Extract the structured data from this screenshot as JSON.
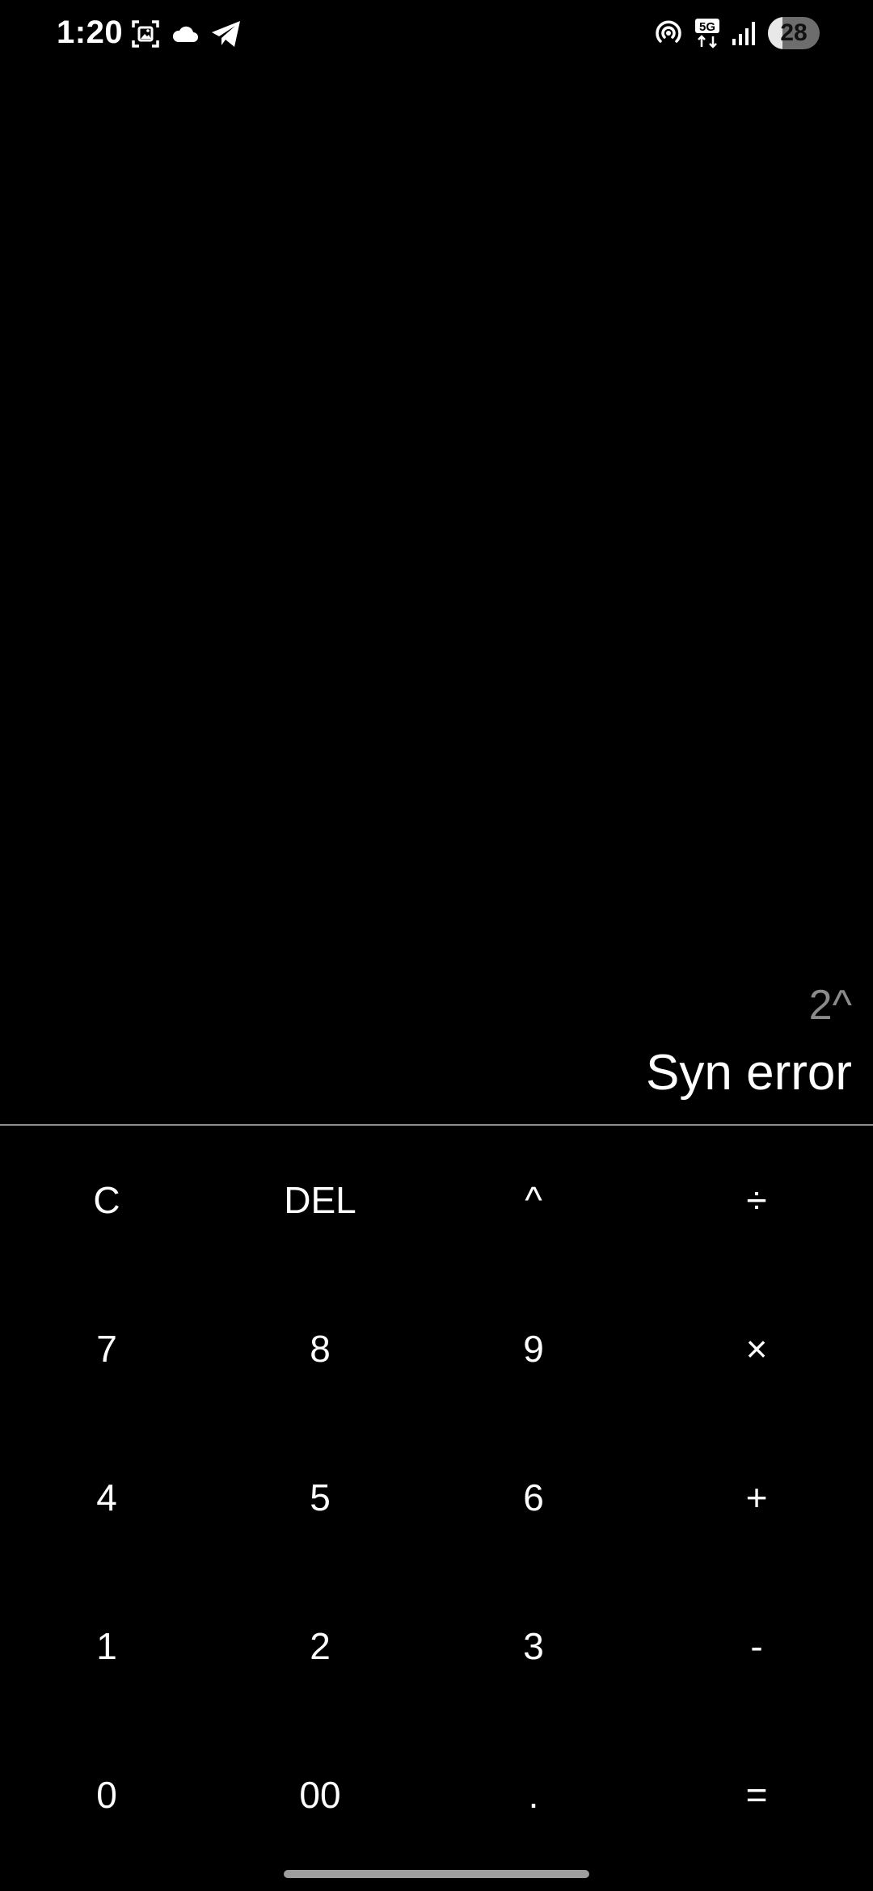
{
  "status_bar": {
    "time": "1:20",
    "left_icons": [
      "screenshot-icon",
      "cloud-icon",
      "telegram-icon"
    ],
    "right_icons": [
      "hotspot-icon",
      "5g-icon",
      "signal-icon"
    ],
    "network_label": "5G",
    "battery_level": "28",
    "battery_fraction": 0.28
  },
  "display": {
    "expression": "2^",
    "result": "Syn error",
    "expression_color": "#8a8a8a",
    "result_color": "#ffffff"
  },
  "keypad": {
    "keys": [
      {
        "label": "C",
        "name": "clear-key"
      },
      {
        "label": "DEL",
        "name": "delete-key"
      },
      {
        "label": "^",
        "name": "power-key"
      },
      {
        "label": "÷",
        "name": "divide-key"
      },
      {
        "label": "7",
        "name": "digit-7-key"
      },
      {
        "label": "8",
        "name": "digit-8-key"
      },
      {
        "label": "9",
        "name": "digit-9-key"
      },
      {
        "label": "×",
        "name": "multiply-key"
      },
      {
        "label": "4",
        "name": "digit-4-key"
      },
      {
        "label": "5",
        "name": "digit-5-key"
      },
      {
        "label": "6",
        "name": "digit-6-key"
      },
      {
        "label": "+",
        "name": "add-key"
      },
      {
        "label": "1",
        "name": "digit-1-key"
      },
      {
        "label": "2",
        "name": "digit-2-key"
      },
      {
        "label": "3",
        "name": "digit-3-key"
      },
      {
        "label": "-",
        "name": "subtract-key"
      },
      {
        "label": "0",
        "name": "digit-0-key"
      },
      {
        "label": "00",
        "name": "double-zero-key"
      },
      {
        "label": ".",
        "name": "decimal-key"
      },
      {
        "label": "=",
        "name": "equals-key"
      }
    ]
  },
  "colors": {
    "background": "#000000",
    "text": "#ffffff",
    "divider": "#8f8f8f"
  }
}
